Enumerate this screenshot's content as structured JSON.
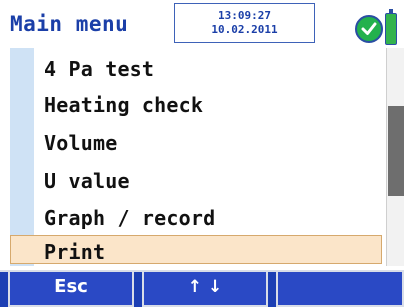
{
  "header": {
    "title": "Main menu",
    "time": "13:09:27",
    "date": "10.02.2011",
    "status_icon": "checkmark-ok-icon",
    "battery_icon": "battery-icon"
  },
  "menu": {
    "items": [
      {
        "label": "4 Pa test"
      },
      {
        "label": "Heating check"
      },
      {
        "label": "Volume"
      },
      {
        "label": "U value"
      },
      {
        "label": "Graph / record"
      },
      {
        "label": "Print",
        "selected": true
      }
    ]
  },
  "softkeys": {
    "left": "Esc",
    "center": "↑ ↓",
    "right": ""
  },
  "colors": {
    "accent": "#1b3fa8",
    "softkey_bg": "#2a49c5",
    "selected_bg": "#fbe5c9",
    "ok_green": "#23b14d"
  }
}
